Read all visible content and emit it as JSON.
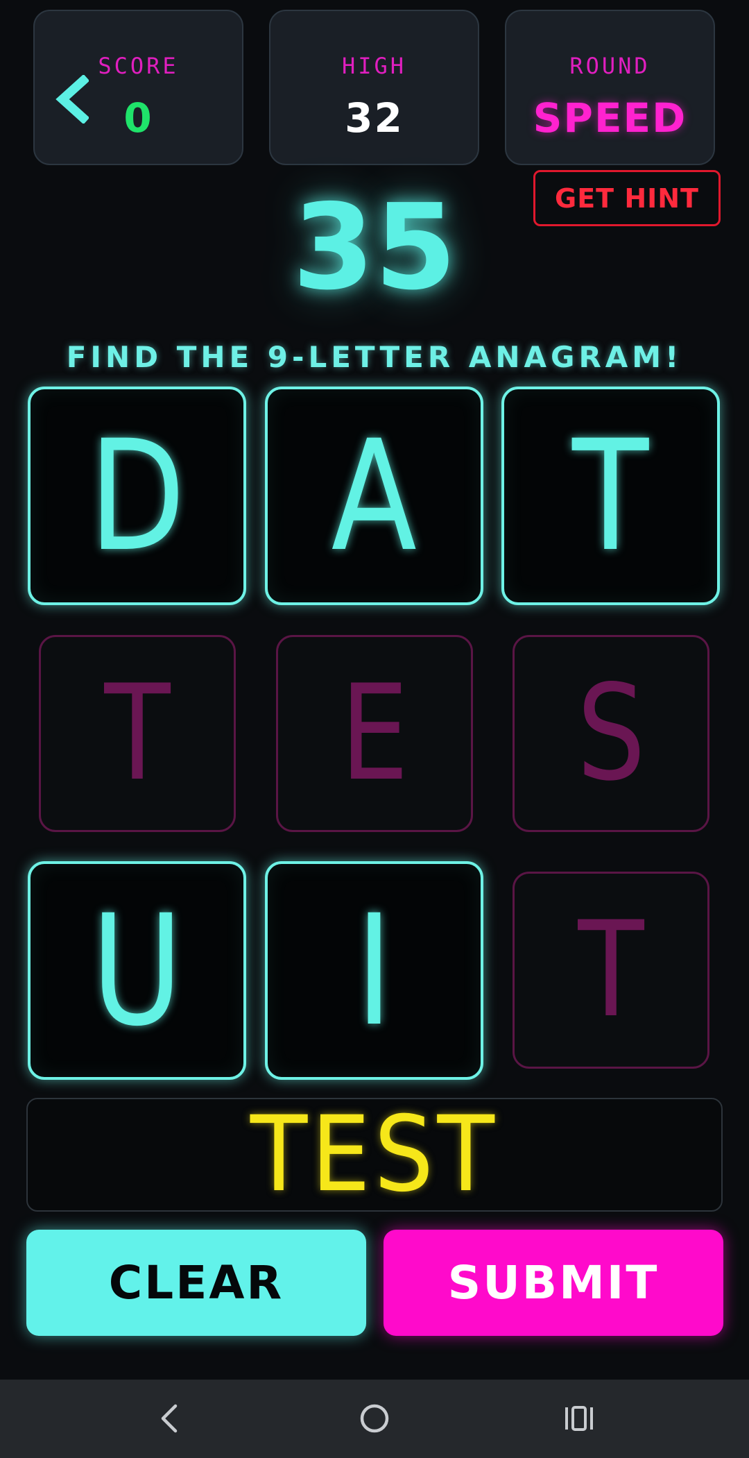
{
  "stats": {
    "score": {
      "label": "SCORE",
      "value": "0"
    },
    "high": {
      "label": "HIGH",
      "value": "32"
    },
    "round": {
      "label": "ROUND",
      "value": "SPEED"
    }
  },
  "hint_button": "GET HINT",
  "timer": "35",
  "instruction": "FIND THE 9-LETTER ANAGRAM!",
  "tiles": [
    {
      "letter": "D",
      "state": "active"
    },
    {
      "letter": "A",
      "state": "active"
    },
    {
      "letter": "T",
      "state": "active"
    },
    {
      "letter": "T",
      "state": "used"
    },
    {
      "letter": "E",
      "state": "used"
    },
    {
      "letter": "S",
      "state": "used"
    },
    {
      "letter": "U",
      "state": "active"
    },
    {
      "letter": "I",
      "state": "active"
    },
    {
      "letter": "T",
      "state": "used"
    }
  ],
  "answer": "TEST",
  "buttons": {
    "clear": "CLEAR",
    "submit": "SUBMIT"
  },
  "colors": {
    "cyan": "#62f2e4",
    "magenta": "#ff0acb",
    "score_green": "#1fe36a",
    "answer_yellow": "#f6e71a",
    "hint_red": "#e0182d",
    "used_tile": "#5a1545"
  },
  "icons": {
    "back": "chevron-left-icon",
    "nav_back": "android-back-icon",
    "nav_home": "android-home-icon",
    "nav_recents": "android-recents-icon"
  }
}
